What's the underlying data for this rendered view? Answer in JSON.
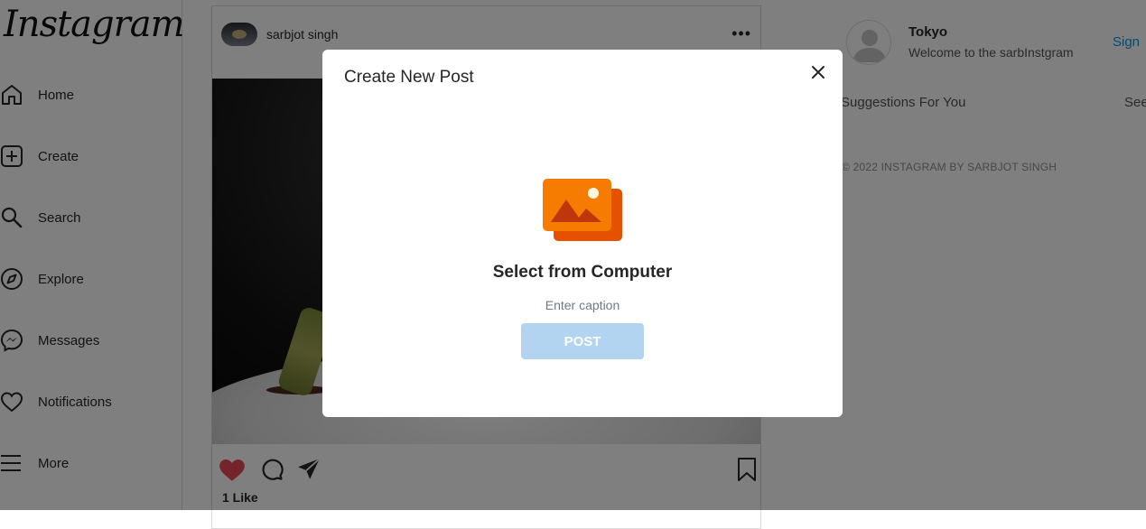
{
  "sidebar": {
    "logo": "Instagram",
    "items": [
      {
        "label": "Home",
        "icon": "home-icon"
      },
      {
        "label": "Create",
        "icon": "plus-square-icon"
      },
      {
        "label": "Search",
        "icon": "search-icon"
      },
      {
        "label": "Explore",
        "icon": "compass-icon"
      },
      {
        "label": "Messages",
        "icon": "messenger-icon"
      },
      {
        "label": "Notifications",
        "icon": "heart-icon"
      },
      {
        "label": "More",
        "icon": "menu-icon"
      }
    ]
  },
  "post": {
    "username": "sarbjot singh",
    "more": "•••",
    "likes": "1 Like",
    "like_color": "#ed4956"
  },
  "right_panel": {
    "name": "Tokyo",
    "welcome": "Welcome to the sarbInstgram",
    "sign_in": "Sign",
    "suggestions": "Suggestions For You",
    "see_all": "See",
    "copyright": "© 2022 INSTAGRAM BY SARBJOT SINGH",
    "link_color": "#0095f6"
  },
  "modal": {
    "title": "Create New Post",
    "select_text": "Select from Computer",
    "caption_placeholder": "Enter caption",
    "caption_value": "",
    "post_button": "POST",
    "icon": "photos-icon",
    "icon_colors": {
      "front": "#f57c00",
      "back": "#e65100"
    },
    "button_color": "#b2d4f0"
  }
}
